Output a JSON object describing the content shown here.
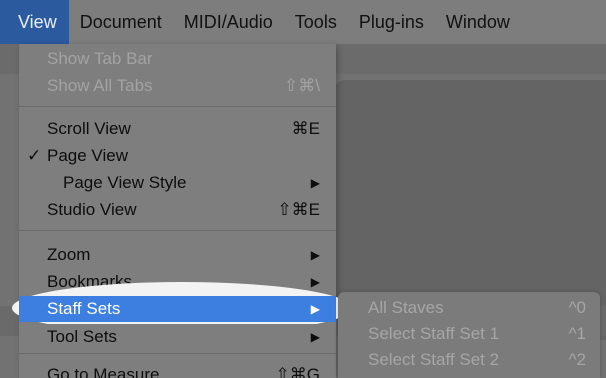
{
  "menubar": {
    "items": [
      "View",
      "Document",
      "MIDI/Audio",
      "Tools",
      "Plug-ins",
      "Window"
    ]
  },
  "menu": {
    "items": [
      {
        "label": "Show Tab Bar",
        "shortcut": "",
        "disabled": true
      },
      {
        "label": "Show All Tabs",
        "shortcut": "⇧⌘\\",
        "disabled": true
      },
      {
        "label": "Scroll View",
        "shortcut": "⌘E"
      },
      {
        "label": "Page View",
        "shortcut": "",
        "checked": true,
        "check_mark": "✓"
      },
      {
        "label": "Page View Style",
        "submenu": true
      },
      {
        "label": "Studio View",
        "shortcut": "⇧⌘E"
      },
      {
        "label": "Zoom",
        "submenu": true
      },
      {
        "label": "Bookmarks",
        "submenu": true
      },
      {
        "label": "Staff Sets",
        "submenu": true,
        "highlighted": true
      },
      {
        "label": "Tool Sets",
        "submenu": true
      },
      {
        "label": "Go to Measure",
        "shortcut": "⇧⌘G"
      }
    ],
    "arrow_glyph": "▶"
  },
  "submenu": {
    "items": [
      {
        "label": "All Staves",
        "shortcut": "^0"
      },
      {
        "label": "Select Staff Set 1",
        "shortcut": "^1"
      },
      {
        "label": "Select Staff Set 2",
        "shortcut": "^2"
      }
    ]
  },
  "colors": {
    "menubar_active": "#2c5a9f",
    "highlight": "#3d7fe0",
    "disabled_text": "#a3a3a3"
  }
}
